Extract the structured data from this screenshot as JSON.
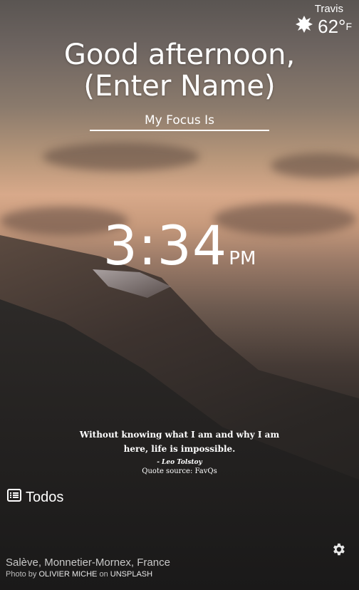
{
  "weather": {
    "location": "Travis",
    "temperature": "62°",
    "unit": "F",
    "icon": "sun-icon"
  },
  "greeting": {
    "line1": "Good afternoon,",
    "line2": "(Enter Name)"
  },
  "focus": {
    "label": "My Focus Is"
  },
  "clock": {
    "time": "3:34",
    "ampm": "PM"
  },
  "quote": {
    "text": "Without knowing what I am and why I am here, life is impossible.",
    "author": "- Leo Tolstoy",
    "source": "Quote source: FavQs"
  },
  "todos": {
    "label": "Todos",
    "icon": "list-icon"
  },
  "photo": {
    "location": "Salève, Monnetier-Mornex, France",
    "prefix": "Photo by",
    "photographer": "OLIVIER MICHE",
    "on": "on",
    "site": "UNSPLASH"
  },
  "settings": {
    "icon": "gear-icon"
  }
}
